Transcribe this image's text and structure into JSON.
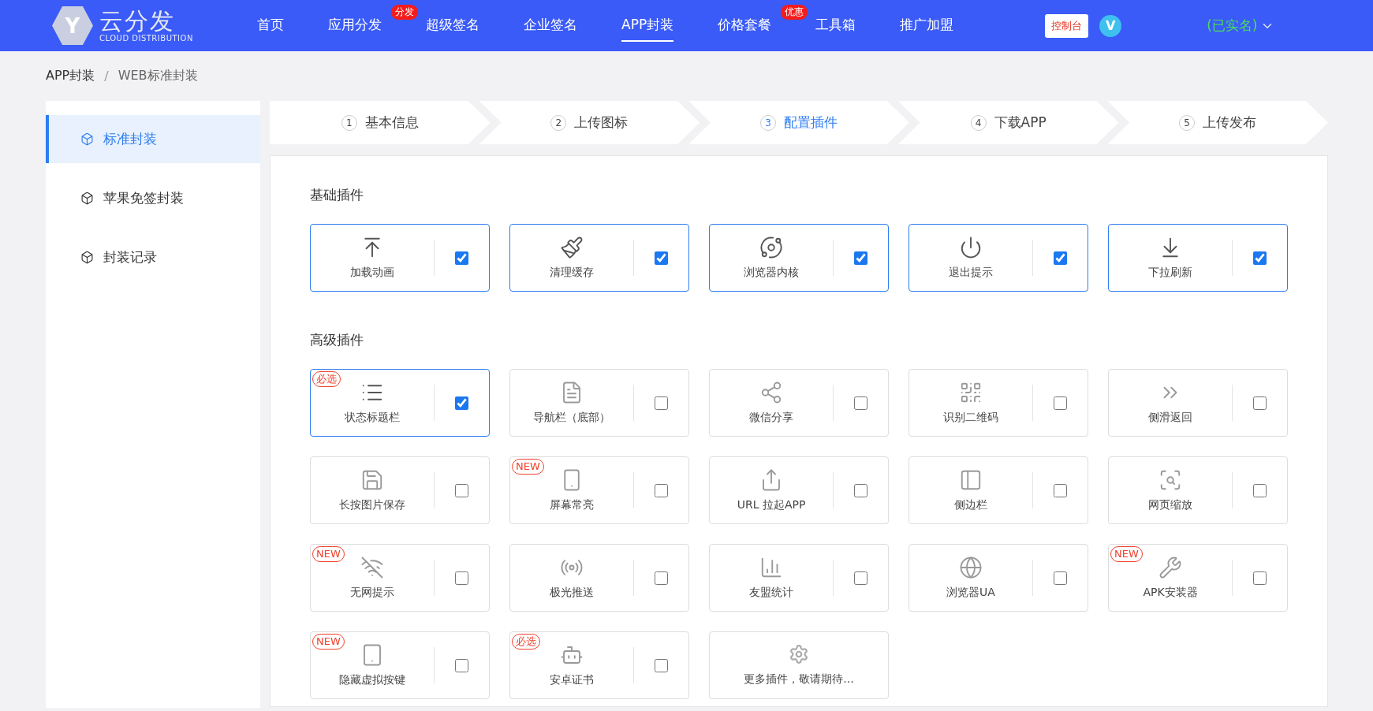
{
  "header": {
    "logo_letter": "Y",
    "logo_title": "云分发",
    "logo_subtitle": "CLOUD DISTRIBUTION",
    "nav": [
      {
        "label": "首页",
        "selected": false
      },
      {
        "label": "应用分发",
        "selected": false,
        "badge": "分发"
      },
      {
        "label": "超级签名",
        "selected": false
      },
      {
        "label": "企业签名",
        "selected": false
      },
      {
        "label": "APP封装",
        "selected": true
      },
      {
        "label": "价格套餐",
        "selected": false,
        "badge": "优惠"
      },
      {
        "label": "工具箱",
        "selected": false
      },
      {
        "label": "推广加盟",
        "selected": false
      }
    ],
    "console_button": "控制台",
    "avatar_letter": "V",
    "user_status": "(已实名)"
  },
  "breadcrumb": [
    "APP封装",
    "WEB标准封装"
  ],
  "breadcrumb_separator": "/",
  "sidebar": {
    "items": [
      {
        "label": "标准封装",
        "selected": true
      },
      {
        "label": "苹果免签封装",
        "selected": false
      },
      {
        "label": "封装记录",
        "selected": false
      }
    ]
  },
  "steps": [
    {
      "number": "1",
      "label": "基本信息",
      "selected": false
    },
    {
      "number": "2",
      "label": "上传图标",
      "selected": false
    },
    {
      "number": "3",
      "label": "配置插件",
      "selected": true
    },
    {
      "number": "4",
      "label": "下载APP",
      "selected": false
    },
    {
      "number": "5",
      "label": "上传发布",
      "selected": false
    }
  ],
  "sections": [
    {
      "title": "基础插件",
      "plugins": [
        {
          "kind": "plugin",
          "label": "加载动画",
          "checked": true
        },
        {
          "kind": "plugin",
          "label": "清理缓存",
          "checked": true
        },
        {
          "kind": "plugin",
          "label": "浏览器内核",
          "checked": true
        },
        {
          "kind": "plugin",
          "label": "退出提示",
          "checked": true
        },
        {
          "kind": "plugin",
          "label": "下拉刷新",
          "checked": true
        }
      ]
    },
    {
      "title": "高级插件",
      "plugins": [
        {
          "kind": "plugin",
          "label": "状态标题栏",
          "checked": true,
          "badge": "必选"
        },
        {
          "kind": "plugin",
          "label": "导航栏（底部）",
          "checked": false
        },
        {
          "kind": "plugin",
          "label": "微信分享",
          "checked": false
        },
        {
          "kind": "plugin",
          "label": "识别二维码",
          "checked": false
        },
        {
          "kind": "plugin",
          "label": "侧滑返回",
          "checked": false
        },
        {
          "kind": "plugin",
          "label": "长按图片保存",
          "checked": false
        },
        {
          "kind": "plugin",
          "label": "屏幕常亮",
          "checked": false,
          "badge": "NEW"
        },
        {
          "kind": "plugin",
          "label": "URL 拉起APP",
          "checked": false
        },
        {
          "kind": "plugin",
          "label": "侧边栏",
          "checked": false
        },
        {
          "kind": "plugin",
          "label": "网页缩放",
          "checked": false
        },
        {
          "kind": "plugin",
          "label": "无网提示",
          "checked": false,
          "badge": "NEW"
        },
        {
          "kind": "plugin",
          "label": "极光推送",
          "checked": false
        },
        {
          "kind": "plugin",
          "label": "友盟统计",
          "checked": false
        },
        {
          "kind": "plugin",
          "label": "浏览器UA",
          "checked": false
        },
        {
          "kind": "plugin",
          "label": "APK安装器",
          "checked": false,
          "badge": "NEW"
        },
        {
          "kind": "plugin",
          "label": "隐藏虚拟按键",
          "checked": false,
          "badge": "NEW"
        },
        {
          "kind": "plugin",
          "label": "安卓证书",
          "checked": false,
          "badge": "必选"
        },
        {
          "kind": "more",
          "label": "更多插件，敬请期待..."
        }
      ]
    }
  ]
}
